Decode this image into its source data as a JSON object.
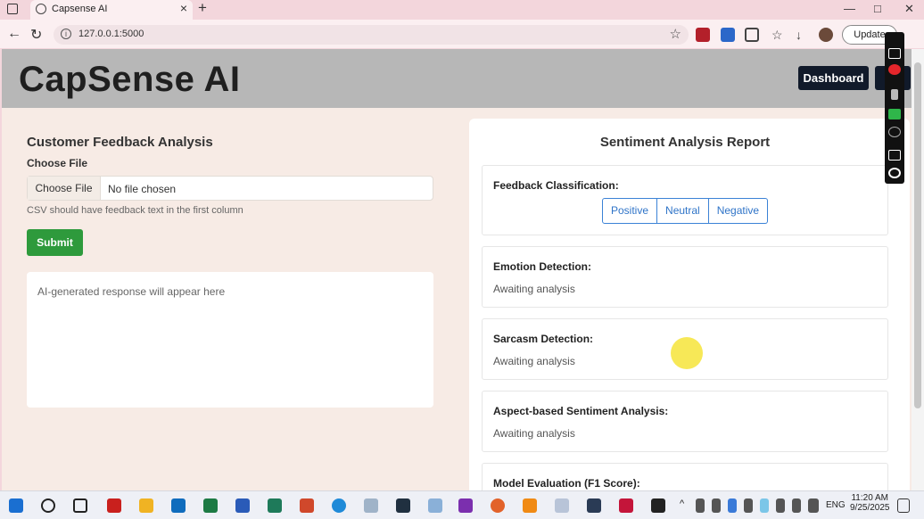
{
  "browser": {
    "tab_title": "Capsense AI",
    "url": "127.0.0.1:5000",
    "update_label": "Update",
    "new_tab_symbol": "+",
    "close_tab_symbol": "×"
  },
  "header": {
    "brand": "CapSense AI",
    "dashboard_label": "Dashboard"
  },
  "upload_panel": {
    "title": "Customer Feedback Analysis",
    "choose_label": "Choose File",
    "file_button": "Choose File",
    "file_status": "No file chosen",
    "hint": "CSV should have feedback text in the first column",
    "submit_label": "Submit",
    "response_placeholder": "AI-generated response will appear here"
  },
  "report": {
    "title": "Sentiment Analysis Report",
    "classification": {
      "heading": "Feedback Classification:",
      "options": [
        "Positive",
        "Neutral",
        "Negative"
      ]
    },
    "emotion": {
      "heading": "Emotion Detection:",
      "value": "Awaiting analysis"
    },
    "sarcasm": {
      "heading": "Sarcasm Detection:",
      "value": "Awaiting analysis"
    },
    "aspect": {
      "heading": "Aspect-based Sentiment Analysis:",
      "value": "Awaiting analysis"
    },
    "model_eval": {
      "heading": "Model Evaluation (F1 Score):"
    }
  },
  "taskbar": {
    "time": "11:20 AM",
    "date": "9/25/2025",
    "language": "ENG"
  },
  "colors": {
    "header_bg": "#b7b7b7",
    "submit_green": "#2e9a3c",
    "dashboard_dark": "#111a2a",
    "outline_blue": "#3b82d6"
  }
}
